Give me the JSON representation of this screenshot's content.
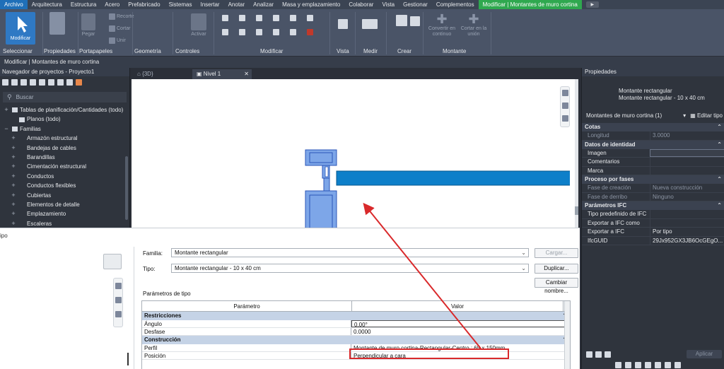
{
  "menu": {
    "items": [
      "Archivo",
      "Arquitectura",
      "Estructura",
      "Acero",
      "Prefabricado",
      "Sistemas",
      "Insertar",
      "Anotar",
      "Analizar",
      "Masa y emplazamiento",
      "Colaborar",
      "Vista",
      "Gestionar",
      "Complementos",
      "Modificar | Montantes de muro cortina"
    ]
  },
  "ribbon": {
    "modify_label": "Modificar",
    "pegar": "Pegar",
    "recortar": "Recorte",
    "cortar": "Cortar",
    "unir": "Unir",
    "activar": "Activar",
    "convertir": "Convertir en continuo",
    "cortar_union": "Cortar en la unión",
    "groups": [
      "Seleccionar",
      "Propiedades",
      "Portapapeles",
      "Geometría",
      "Controles",
      "Modificar",
      "Vista",
      "Medir",
      "Crear",
      "Montante"
    ]
  },
  "context": "Modificar | Montantes de muro cortina",
  "browser": {
    "title": "Navegador de proyectos - Proyecto1",
    "search_placeholder": "Buscar",
    "tree": [
      {
        "label": "Tablas de planificación/Cantidades (todo)",
        "exp": "+",
        "indent": 0
      },
      {
        "label": "Planos (todo)",
        "exp": "",
        "indent": 1
      },
      {
        "label": "Familias",
        "exp": "−",
        "indent": 0
      },
      {
        "label": "Armazón estructural",
        "exp": "+",
        "indent": 1
      },
      {
        "label": "Bandejas de cables",
        "exp": "+",
        "indent": 1
      },
      {
        "label": "Barandillas",
        "exp": "+",
        "indent": 1
      },
      {
        "label": "Cimentación estructural",
        "exp": "+",
        "indent": 1
      },
      {
        "label": "Conductos",
        "exp": "+",
        "indent": 1
      },
      {
        "label": "Conductos flexibles",
        "exp": "+",
        "indent": 1
      },
      {
        "label": "Cubiertas",
        "exp": "+",
        "indent": 1
      },
      {
        "label": "Elementos de detalle",
        "exp": "+",
        "indent": 1
      },
      {
        "label": "Emplazamiento",
        "exp": "+",
        "indent": 1
      },
      {
        "label": "Escaleras",
        "exp": "+",
        "indent": 1
      }
    ]
  },
  "views": {
    "tab_3d": "{3D}",
    "tab_nivel": "Nivel 1"
  },
  "properties": {
    "title": "Propiedades",
    "type_line1": "Montante rectangular",
    "type_line2": "Montante rectangular - 10 x 40 cm",
    "filter": "Montantes de muro cortina (1)",
    "edit_type": "Editar tipo",
    "sections": [
      {
        "name": "Cotas",
        "rows": [
          {
            "k": "Longitud",
            "v": "3.0000",
            "dim": true
          }
        ]
      },
      {
        "name": "Datos de identidad",
        "rows": [
          {
            "k": "Imagen",
            "v": ""
          },
          {
            "k": "Comentarios",
            "v": ""
          },
          {
            "k": "Marca",
            "v": ""
          }
        ]
      },
      {
        "name": "Proceso por fases",
        "rows": [
          {
            "k": "Fase de creación",
            "v": "Nueva construcción",
            "dim": true
          },
          {
            "k": "Fase de derribo",
            "v": "Ninguno",
            "dim": true
          }
        ]
      },
      {
        "name": "Parámetros IFC",
        "rows": [
          {
            "k": "Tipo predefinido de IFC",
            "v": ""
          },
          {
            "k": "Exportar a IFC como",
            "v": ""
          },
          {
            "k": "Exportar a IFC",
            "v": "Por tipo"
          },
          {
            "k": "IfcGUID",
            "v": "29Jx952GX3JB6OcGEgO..."
          }
        ]
      }
    ],
    "apply": "Aplicar"
  },
  "dialog": {
    "title_partial": "ipo",
    "familia_label": "Familia:",
    "familia_value": "Montante rectangular",
    "tipo_label": "Tipo:",
    "tipo_value": "Montante rectangular - 10 x 40 cm",
    "cargar": "Cargar...",
    "duplicar": "Duplicar...",
    "cambiar_nombre": "Cambiar nombre...",
    "params_label": "Parámetros de tipo",
    "col_param": "Parámetro",
    "col_valor": "Valor",
    "sections": [
      {
        "name": "Restricciones",
        "rows": [
          {
            "k": "Ángulo",
            "v": "0.00°",
            "edit": true
          },
          {
            "k": "Desfase",
            "v": "0.0000"
          }
        ]
      },
      {
        "name": "Construcción",
        "rows": [
          {
            "k": "Perfil",
            "v": "Montante de muro cortina-Rectangular-Centro : 65 x 150mm"
          },
          {
            "k": "Posición",
            "v": "Perpendicular a cara"
          }
        ]
      }
    ]
  },
  "colors": {
    "accent": "#1f6fb8",
    "context_tab": "#2fa84f",
    "highlight": "#d9292b",
    "mullion_fill": "#7da6e8",
    "wall_fill": "#0d7fc9"
  }
}
